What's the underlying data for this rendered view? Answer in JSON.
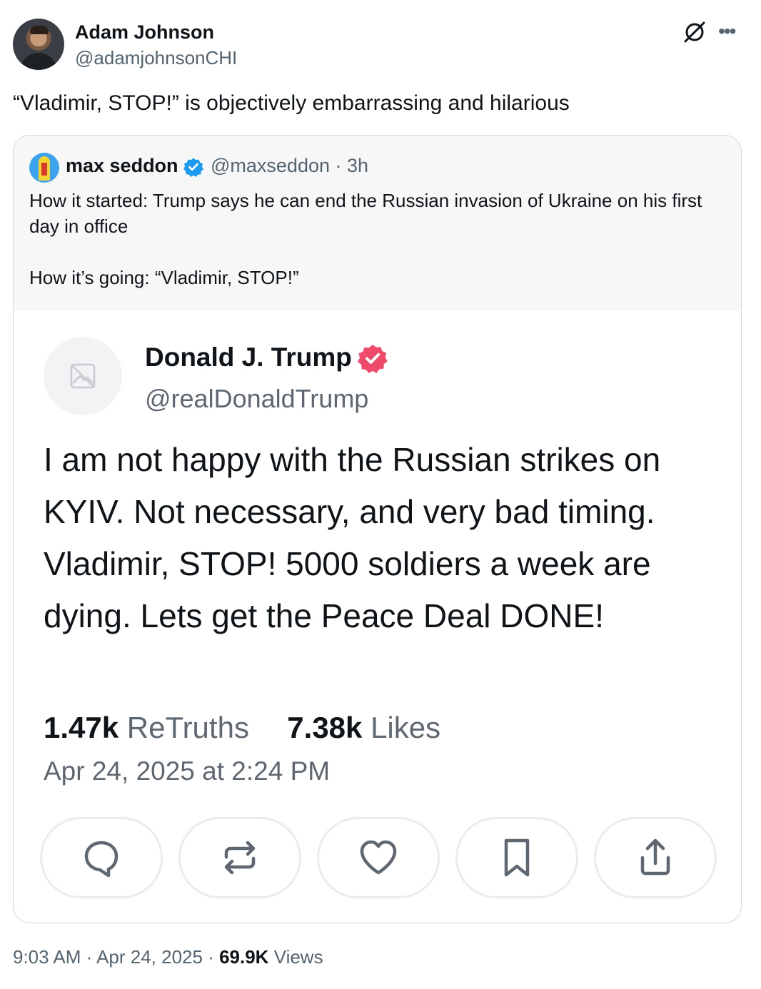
{
  "author": {
    "name": "Adam Johnson",
    "handle": "@adamjohnsonCHI",
    "avatar_icon": "profile-photo"
  },
  "tweet": {
    "text": "“Vladimir, STOP!” is objectively embarrassing and hilarious"
  },
  "header_icons": [
    "grok-icon",
    "more-icon"
  ],
  "quoted": {
    "name": "max seddon",
    "handle_time": "@maxseddon · 3h",
    "verified_color": "#1d9bf0",
    "line1": "How it started: Trump says he can end the Russian invasion of Ukraine on his first day in office",
    "line2": "How it’s going: “Vladimir, STOP!”"
  },
  "truth": {
    "name": "Donald J. Trump",
    "handle": "@realDonaldTrump",
    "badge_color": "#f04a6a",
    "text": "I am not happy with the Russian strikes on KYIV. Not necessary, and very bad timing. Vladimir, STOP! 5000 soldiers a week are dying. Lets get the Peace Deal DONE!",
    "retruths_count": "1.47k",
    "retruths_label": "ReTruths",
    "likes_count": "7.38k",
    "likes_label": "Likes",
    "date": "Apr 24, 2025 at 2:24 PM",
    "actions": [
      "reply-icon",
      "retruth-icon",
      "like-icon",
      "bookmark-icon",
      "share-icon"
    ]
  },
  "meta": {
    "time": "9:03 AM",
    "sep1": " · ",
    "date": "Apr 24, 2025",
    "sep2": " · ",
    "views_count": "69.9K",
    "views_label": "Views"
  }
}
